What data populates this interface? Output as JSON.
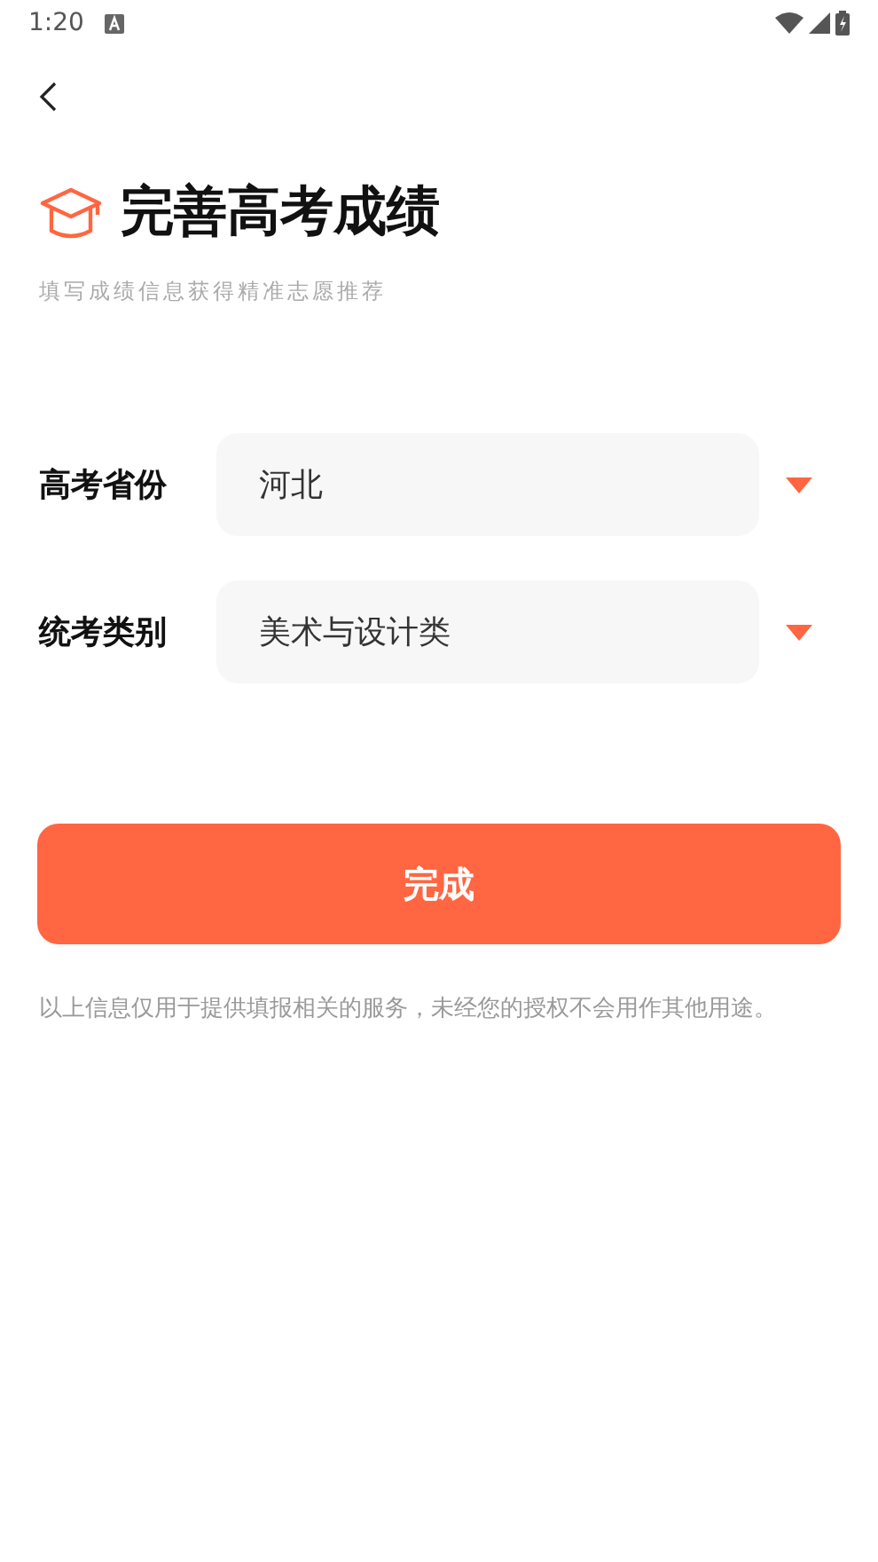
{
  "status_bar": {
    "time": "1:20"
  },
  "header": {
    "title": "完善高考成绩",
    "subtitle": "填写成绩信息获得精准志愿推荐"
  },
  "fields": [
    {
      "label": "高考省份",
      "value": "河北"
    },
    {
      "label": "统考类别",
      "value": "美术与设计类"
    }
  ],
  "submit_button": {
    "label": "完成"
  },
  "note": "以上信息仅用于提供填报相关的服务，未经您的授权不会用作其他用途。"
}
